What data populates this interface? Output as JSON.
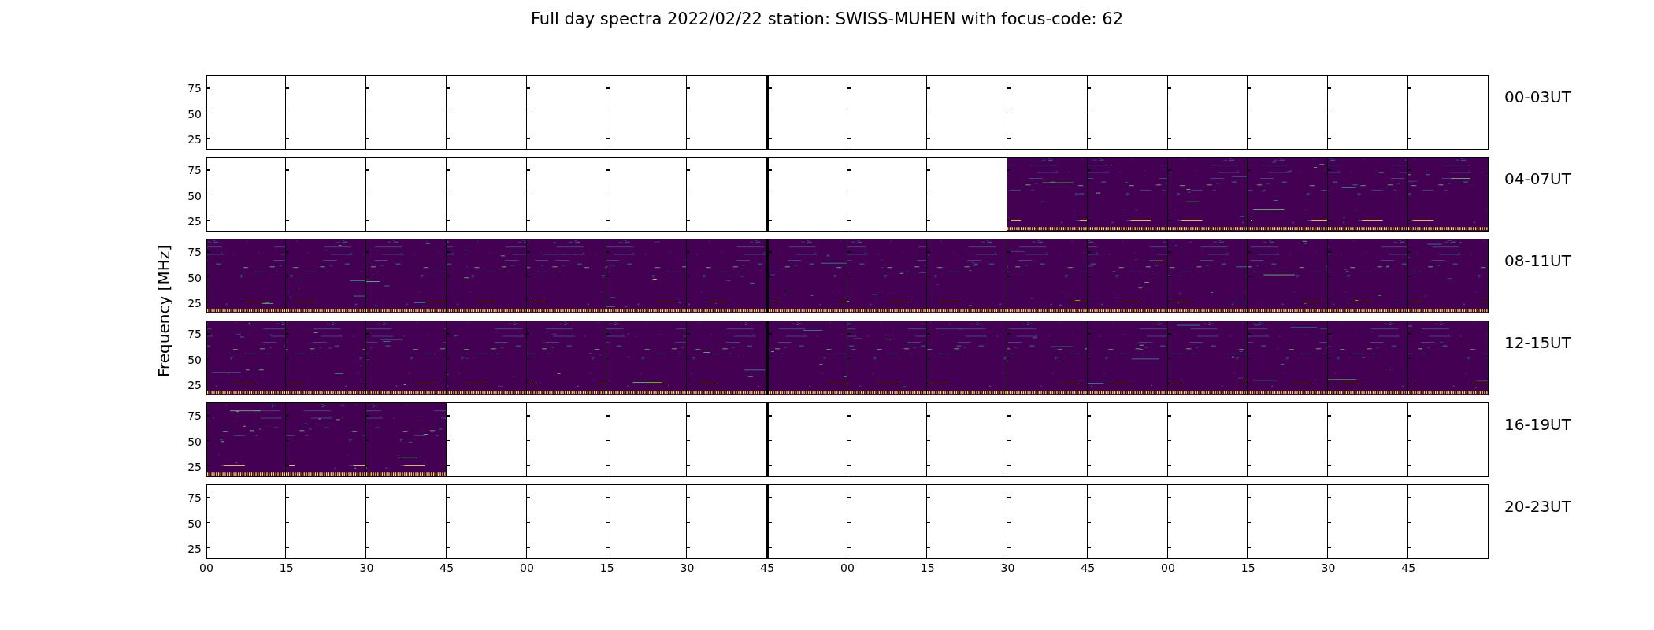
{
  "title": "Full day spectra 2022/02/22 station: SWISS-MUHEN with focus-code: 62",
  "ylabel": "Frequency [MHz]",
  "xticks": [
    "00",
    "15",
    "30",
    "45",
    "00",
    "15",
    "30",
    "45",
    "00",
    "15",
    "30",
    "45",
    "00",
    "15",
    "30",
    "45"
  ],
  "rows": [
    {
      "label": "00-03UT",
      "yticks": [
        "75",
        "50",
        "25"
      ],
      "panels": [
        {
          "has_data": false
        },
        {
          "has_data": false
        },
        {
          "has_data": false
        },
        {
          "has_data": false
        },
        {
          "has_data": false
        },
        {
          "has_data": false
        },
        {
          "has_data": false
        },
        {
          "has_data": false
        },
        {
          "has_data": false
        },
        {
          "has_data": false
        },
        {
          "has_data": false
        },
        {
          "has_data": false
        },
        {
          "has_data": false
        },
        {
          "has_data": false
        },
        {
          "has_data": false
        },
        {
          "has_data": false
        }
      ]
    },
    {
      "label": "04-07UT",
      "yticks": [
        "75",
        "50",
        "25"
      ],
      "panels": [
        {
          "has_data": false
        },
        {
          "has_data": false
        },
        {
          "has_data": false
        },
        {
          "has_data": false
        },
        {
          "has_data": false
        },
        {
          "has_data": false
        },
        {
          "has_data": false
        },
        {
          "has_data": false
        },
        {
          "has_data": false
        },
        {
          "has_data": false
        },
        {
          "has_data": true
        },
        {
          "has_data": true
        },
        {
          "has_data": true
        },
        {
          "has_data": true
        },
        {
          "has_data": true
        },
        {
          "has_data": true
        }
      ]
    },
    {
      "label": "08-11UT",
      "yticks": [
        "75",
        "50",
        "25"
      ],
      "panels": [
        {
          "has_data": true
        },
        {
          "has_data": true
        },
        {
          "has_data": true
        },
        {
          "has_data": true
        },
        {
          "has_data": true
        },
        {
          "has_data": true
        },
        {
          "has_data": true
        },
        {
          "has_data": true
        },
        {
          "has_data": true
        },
        {
          "has_data": true
        },
        {
          "has_data": true
        },
        {
          "has_data": true
        },
        {
          "has_data": true
        },
        {
          "has_data": true
        },
        {
          "has_data": true
        },
        {
          "has_data": true
        }
      ]
    },
    {
      "label": "12-15UT",
      "yticks": [
        "75",
        "50",
        "25"
      ],
      "panels": [
        {
          "has_data": true
        },
        {
          "has_data": true
        },
        {
          "has_data": true
        },
        {
          "has_data": true
        },
        {
          "has_data": true
        },
        {
          "has_data": true
        },
        {
          "has_data": true
        },
        {
          "has_data": true
        },
        {
          "has_data": true
        },
        {
          "has_data": true
        },
        {
          "has_data": true
        },
        {
          "has_data": true
        },
        {
          "has_data": true
        },
        {
          "has_data": true
        },
        {
          "has_data": true
        },
        {
          "has_data": true
        }
      ]
    },
    {
      "label": "16-19UT",
      "yticks": [
        "75",
        "50",
        "25"
      ],
      "panels": [
        {
          "has_data": true
        },
        {
          "has_data": true
        },
        {
          "has_data": true
        },
        {
          "has_data": false
        },
        {
          "has_data": false
        },
        {
          "has_data": false
        },
        {
          "has_data": false
        },
        {
          "has_data": false
        },
        {
          "has_data": false
        },
        {
          "has_data": false
        },
        {
          "has_data": false
        },
        {
          "has_data": false
        },
        {
          "has_data": false
        },
        {
          "has_data": false
        },
        {
          "has_data": false
        },
        {
          "has_data": false
        }
      ]
    },
    {
      "label": "20-23UT",
      "yticks": [
        "75",
        "50",
        "25"
      ],
      "panels": [
        {
          "has_data": false
        },
        {
          "has_data": false
        },
        {
          "has_data": false
        },
        {
          "has_data": false
        },
        {
          "has_data": false
        },
        {
          "has_data": false
        },
        {
          "has_data": false
        },
        {
          "has_data": false
        },
        {
          "has_data": false
        },
        {
          "has_data": false
        },
        {
          "has_data": false
        },
        {
          "has_data": false
        },
        {
          "has_data": false
        },
        {
          "has_data": false
        },
        {
          "has_data": false
        },
        {
          "has_data": false
        }
      ]
    }
  ]
}
